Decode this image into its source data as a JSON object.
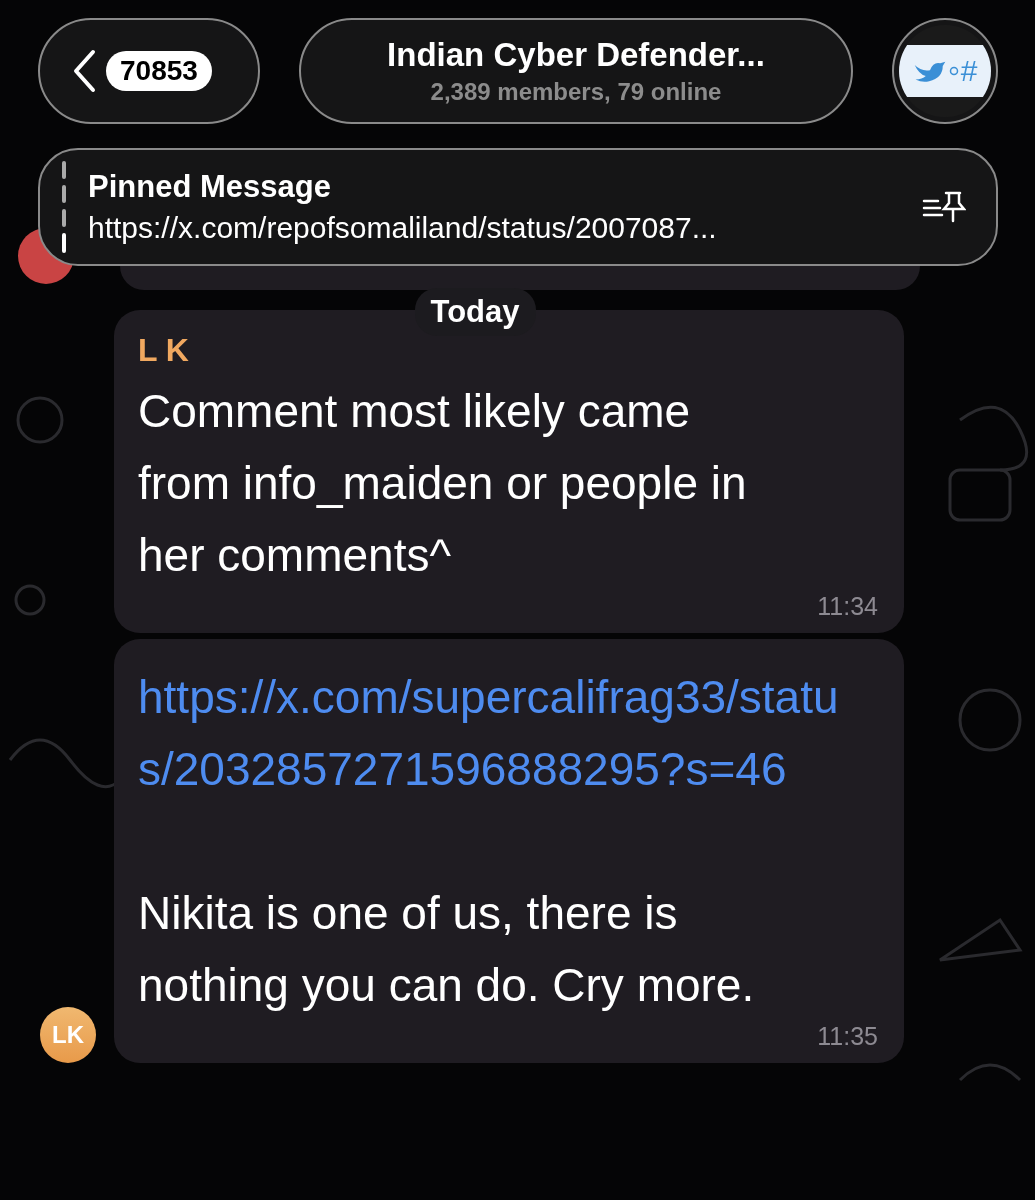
{
  "header": {
    "back_count": "70853",
    "title": "Indian Cyber Defender...",
    "subtitle": "2,389 members, 79 online",
    "avatar_mark": "#"
  },
  "pinned": {
    "label": "Pinned Message",
    "text": "https://x.com/repofsomaliland/status/2007087..."
  },
  "date_divider": "Today",
  "messages": [
    {
      "sender": "L K",
      "time": "11:34",
      "parts": [
        {
          "kind": "text",
          "text": "Comment most likely came from info_maiden or people in her comments^"
        }
      ]
    },
    {
      "time": "11:35",
      "avatar": "LK",
      "parts": [
        {
          "kind": "link",
          "text": "https://x.com/supercalifrag33/status/2032857271596888295?s=46"
        },
        {
          "kind": "text",
          "text": "Nikita is one of us, there is nothing you can do. Cry more."
        }
      ]
    }
  ]
}
